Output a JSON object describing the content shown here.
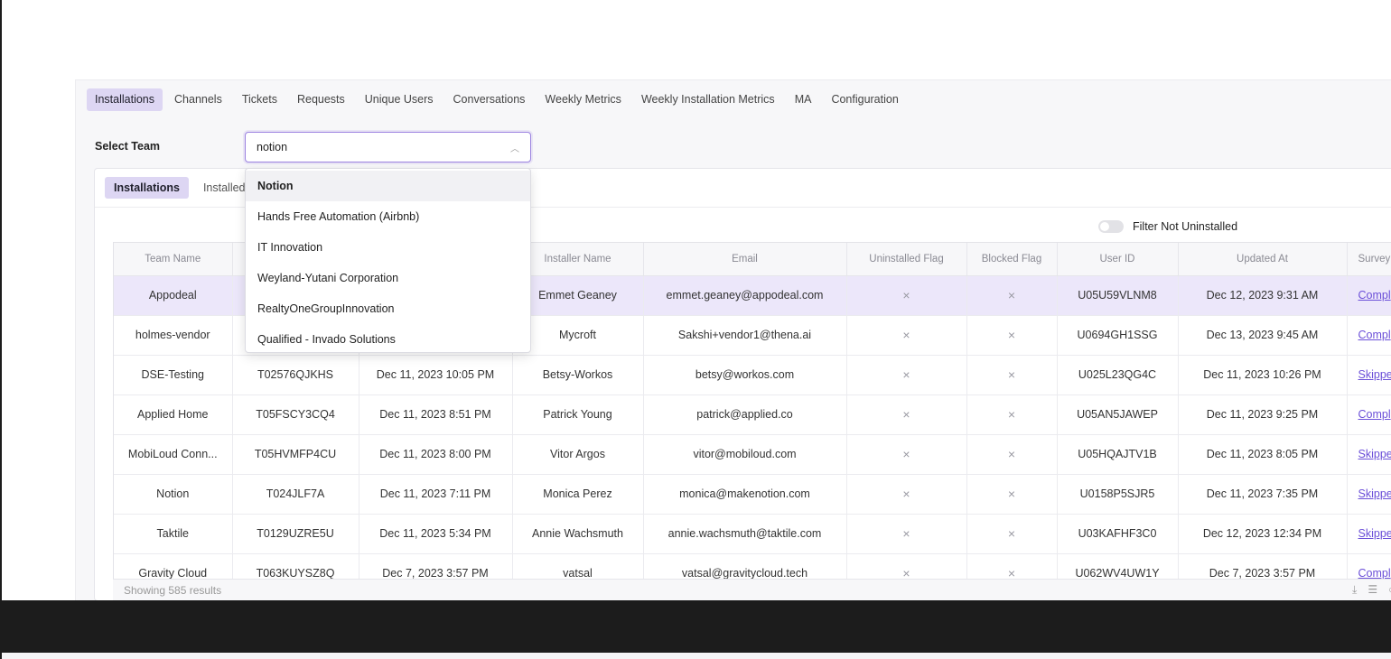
{
  "top_tabs": [
    "Installations",
    "Channels",
    "Tickets",
    "Requests",
    "Unique Users",
    "Conversations",
    "Weekly Metrics",
    "Weekly Installation Metrics",
    "MA",
    "Configuration"
  ],
  "select_team": {
    "label": "Select Team",
    "value": "notion"
  },
  "sub_tabs": [
    "Installations",
    "Installed"
  ],
  "dropdown_options": [
    "Notion",
    "Hands Free Automation (Airbnb)",
    "IT Innovation",
    "Weyland-Yutani Corporation",
    "RealtyOneGroupInnovation",
    "Qualified - Invado Solutions"
  ],
  "filter": {
    "label": "Filter Not Uninstalled",
    "enabled": false
  },
  "table": {
    "headers": [
      "Team Name",
      "",
      "",
      "Installer Name",
      "Email",
      "Uninstalled Flag",
      "Blocked Flag",
      "User ID",
      "Updated At",
      "Survey"
    ],
    "rows": [
      [
        "Appodeal",
        "",
        "",
        "Emmet Geaney",
        "emmet.geaney@appodeal.com",
        "×",
        "×",
        "U05U59VLNM8",
        "Dec 12, 2023 9:31 AM",
        "Compl"
      ],
      [
        "holmes-vendor",
        "",
        "",
        "Mycroft",
        "Sakshi+vendor1@thena.ai",
        "×",
        "×",
        "U0694GH1SSG",
        "Dec 13, 2023 9:45 AM",
        "Compl"
      ],
      [
        "DSE-Testing",
        "T02576QJKHS",
        "Dec 11, 2023 10:05 PM",
        "Betsy-Workos",
        "betsy@workos.com",
        "×",
        "×",
        "U025L23QG4C",
        "Dec 11, 2023 10:26 PM",
        "Skippe"
      ],
      [
        "Applied Home",
        "T05FSCY3CQ4",
        "Dec 11, 2023 8:51 PM",
        "Patrick Young",
        "patrick@applied.co",
        "×",
        "×",
        "U05AN5JAWEP",
        "Dec 11, 2023 9:25 PM",
        "Compl"
      ],
      [
        "MobiLoud Conn...",
        "T05HVMFP4CU",
        "Dec 11, 2023 8:00 PM",
        "Vitor Argos",
        "vitor@mobiloud.com",
        "×",
        "×",
        "U05HQAJTV1B",
        "Dec 11, 2023 8:05 PM",
        "Skippe"
      ],
      [
        "Notion",
        "T024JLF7A",
        "Dec 11, 2023 7:11 PM",
        "Monica Perez",
        "monica@makenotion.com",
        "×",
        "×",
        "U0158P5SJR5",
        "Dec 11, 2023 7:35 PM",
        "Skippe"
      ],
      [
        "Taktile",
        "T0129UZRE5U",
        "Dec 11, 2023 5:34 PM",
        "Annie Wachsmuth",
        "annie.wachsmuth@taktile.com",
        "×",
        "×",
        "U03KAFHF3C0",
        "Dec 12, 2023 12:34 PM",
        "Skippe"
      ],
      [
        "Gravity Cloud",
        "T063KUYSZ8Q",
        "Dec 7, 2023 3:57 PM",
        "vatsal",
        "vatsal@gravitycloud.tech",
        "×",
        "×",
        "U062WV4UW1Y",
        "Dec 7, 2023 3:57 PM",
        "Compl"
      ]
    ],
    "footer": "Showing 585 results"
  },
  "icons": [
    "download-icon",
    "filter-icon",
    "refresh-icon"
  ]
}
